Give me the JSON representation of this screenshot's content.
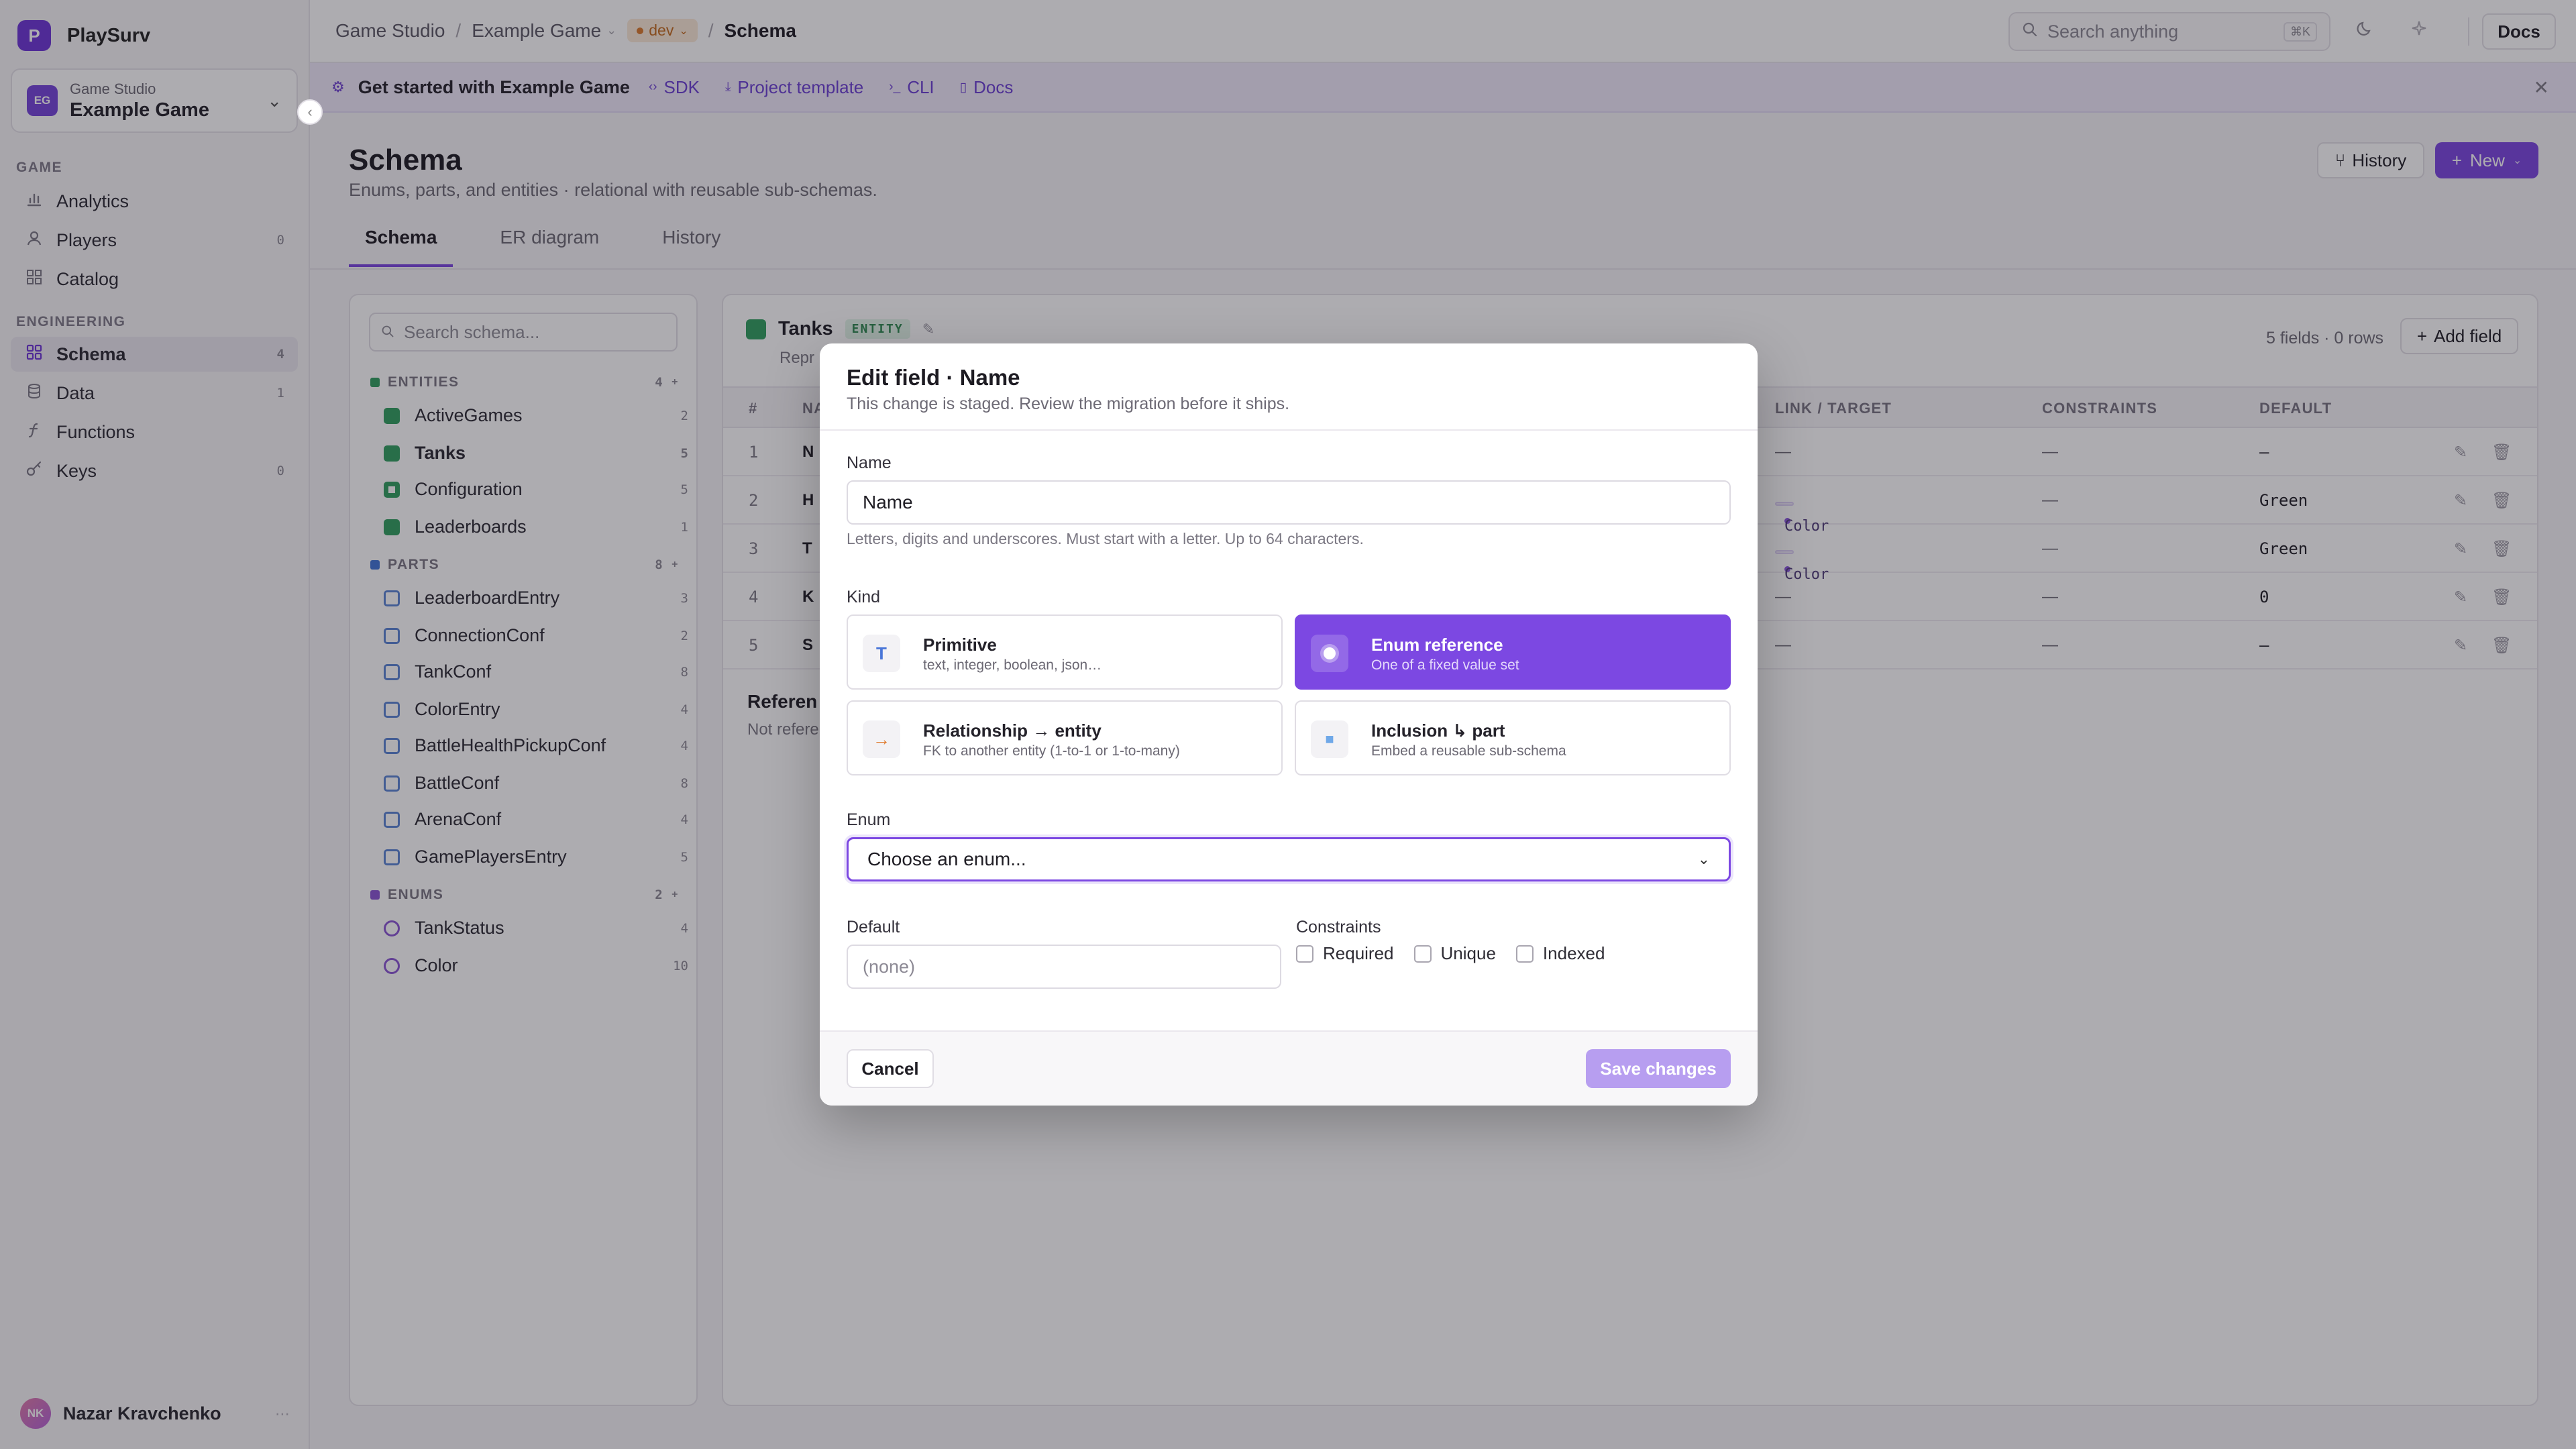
{
  "app": {
    "logo_letter": "P",
    "name": "PlaySurv"
  },
  "workspace": {
    "initials": "EG",
    "org": "Game Studio",
    "name": "Example Game"
  },
  "nav": {
    "game_section": "GAME",
    "game_items": [
      {
        "label": "Analytics",
        "icon": "bar-chart-icon",
        "count": ""
      },
      {
        "label": "Players",
        "icon": "user-icon",
        "count": "0"
      },
      {
        "label": "Catalog",
        "icon": "grid-icon",
        "count": ""
      }
    ],
    "eng_section": "ENGINEERING",
    "eng_items": [
      {
        "label": "Schema",
        "icon": "schema-icon",
        "count": "4",
        "active": true
      },
      {
        "label": "Data",
        "icon": "database-icon",
        "count": "1"
      },
      {
        "label": "Functions",
        "icon": "function-icon",
        "count": ""
      },
      {
        "label": "Keys",
        "icon": "key-icon",
        "count": "0"
      }
    ]
  },
  "user": {
    "initials": "NK",
    "name": "Nazar Kravchenko"
  },
  "topbar": {
    "crumb1": "Game Studio",
    "crumb2": "Example Game",
    "env": "dev",
    "crumb3": "Schema",
    "search_placeholder": "Search anything",
    "search_kbd": "⌘K",
    "docs": "Docs"
  },
  "banner": {
    "title": "Get started with Example Game",
    "links": [
      "SDK",
      "Project template",
      "CLI",
      "Docs"
    ]
  },
  "page": {
    "title": "Schema",
    "subtitle": "Enums, parts, and entities · relational with reusable sub-schemas.",
    "history_btn": "History",
    "new_btn": "New",
    "tabs": [
      "Schema",
      "ER diagram",
      "History"
    ]
  },
  "schema_tree": {
    "search_placeholder": "Search schema...",
    "entities_label": "ENTITIES",
    "entities_count": "4",
    "entities": [
      {
        "name": "ActiveGames",
        "count": "2"
      },
      {
        "name": "Tanks",
        "count": "5"
      },
      {
        "name": "Configuration",
        "count": "5"
      },
      {
        "name": "Leaderboards",
        "count": "1"
      }
    ],
    "parts_label": "PARTS",
    "parts_count": "8",
    "parts": [
      {
        "name": "LeaderboardEntry",
        "count": "3"
      },
      {
        "name": "ConnectionConf",
        "count": "2"
      },
      {
        "name": "TankConf",
        "count": "8"
      },
      {
        "name": "ColorEntry",
        "count": "4"
      },
      {
        "name": "BattleHealthPickupConf",
        "count": "4"
      },
      {
        "name": "BattleConf",
        "count": "8"
      },
      {
        "name": "ArenaConf",
        "count": "4"
      },
      {
        "name": "GamePlayersEntry",
        "count": "5"
      }
    ],
    "enums_label": "ENUMS",
    "enums_count": "2",
    "enums": [
      {
        "name": "TankStatus",
        "count": "4"
      },
      {
        "name": "Color",
        "count": "10"
      }
    ]
  },
  "entity": {
    "name": "Tanks",
    "tag": "ENTITY",
    "desc": "Repr",
    "meta": "5 fields · 0 rows",
    "add_field": "Add field",
    "columns": {
      "num": "#",
      "name": "NA",
      "link": "LINK / TARGET",
      "constraints": "CONSTRAINTS",
      "default": "DEFAULT"
    },
    "rows": [
      {
        "num": "1",
        "name": "N",
        "link": "—",
        "link_pill": "",
        "constraints": "—",
        "default": "—"
      },
      {
        "num": "2",
        "name": "H",
        "link": "",
        "link_pill": "Color",
        "constraints": "—",
        "default": "Green"
      },
      {
        "num": "3",
        "name": "T",
        "link": "",
        "link_pill": "Color",
        "constraints": "—",
        "default": "Green"
      },
      {
        "num": "4",
        "name": "K",
        "link": "—",
        "link_pill": "",
        "constraints": "—",
        "default": "0"
      },
      {
        "num": "5",
        "name": "S",
        "link": "—",
        "link_pill": "",
        "constraints": "—",
        "default": "—"
      }
    ],
    "refs_title": "Referen",
    "refs_sub": "Not refere"
  },
  "modal": {
    "title": "Edit field · Name",
    "subtitle": "This change is staged. Review the migration before it ships.",
    "name_label": "Name",
    "name_value": "Name",
    "name_help": "Letters, digits and underscores. Must start with a letter. Up to 64 characters.",
    "kind_label": "Kind",
    "kinds": [
      {
        "title": "Primitive",
        "sub": "text, integer, boolean, json…",
        "icon": "T",
        "selected": false
      },
      {
        "title": "Enum reference",
        "sub": "One of a fixed value set",
        "icon": "",
        "selected": true
      },
      {
        "title": "Relationship → entity",
        "sub": "FK to another entity (1-to-1 or 1-to-many)",
        "icon": "→",
        "selected": false
      },
      {
        "title": "Inclusion ↳ part",
        "sub": "Embed a reusable sub-schema",
        "icon": "■",
        "selected": false
      }
    ],
    "enum_label": "Enum",
    "enum_value": "Choose an enum...",
    "default_label": "Default",
    "default_placeholder": "(none)",
    "constraints_label": "Constraints",
    "constraints": [
      "Required",
      "Unique",
      "Indexed"
    ],
    "cancel": "Cancel",
    "save": "Save changes"
  }
}
